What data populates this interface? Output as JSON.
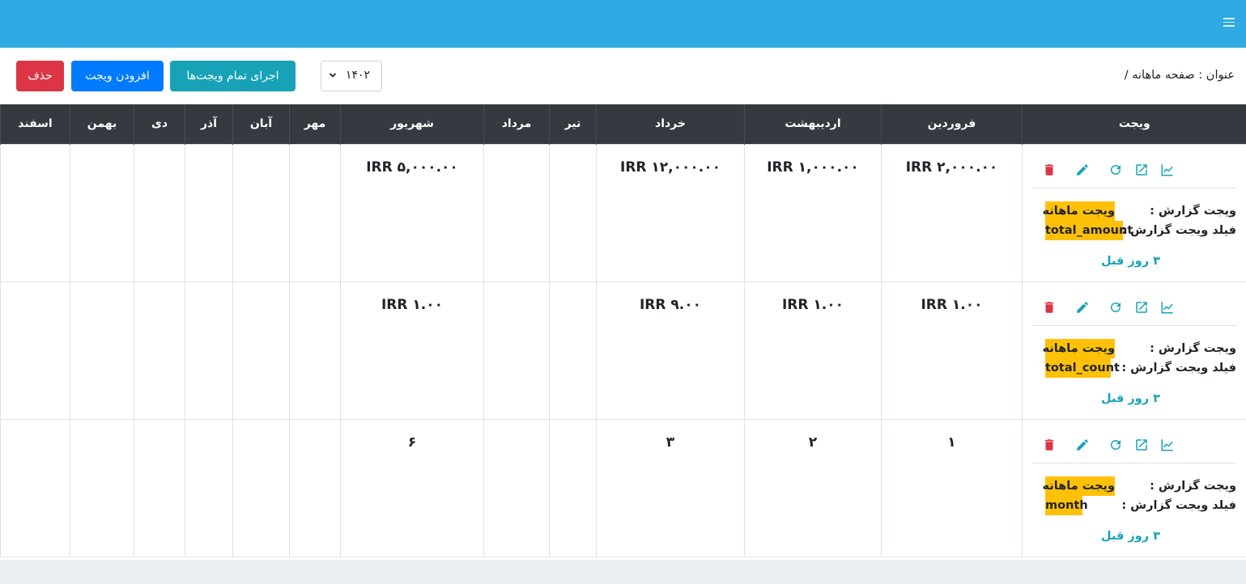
{
  "topbar": {
    "menu_icon": "hamburger-menu-icon",
    "color": "#2ea9e1"
  },
  "toolbar": {
    "title": "عنوان : صفحه ماهانه /",
    "year_value": "۱۴۰۲",
    "run_all_label": "اجرای تمام ویجت‌ها",
    "add_widget_label": "افزودن ویجت",
    "delete_label": "حذف"
  },
  "table": {
    "headers": [
      "ویجت",
      "فروردین",
      "اردیبهشت",
      "خرداد",
      "تیر",
      "مرداد",
      "شهریور",
      "مهر",
      "آبان",
      "آذر",
      "دی",
      "بهمن",
      "اسفند"
    ],
    "rows": [
      {
        "widget_label": "ویجت گزارش :",
        "widget_value": "ویجت ماهانه",
        "field_label": "فیلد ویجت گزارش :",
        "field_value": "total_amount",
        "ago": "۳ روز قبل",
        "cells": [
          "IRR ۲,۰۰۰.۰۰",
          "IRR ۱,۰۰۰.۰۰",
          "IRR ۱۲,۰۰۰.۰۰",
          "",
          "",
          "IRR ۵,۰۰۰.۰۰",
          "",
          "",
          "",
          "",
          "",
          ""
        ]
      },
      {
        "widget_label": "ویجت گزارش :",
        "widget_value": "ویجت ماهانه",
        "field_label": "فیلد ویجت گزارش :",
        "field_value": "total_count",
        "ago": "۳ روز قبل",
        "cells": [
          "IRR ۱.۰۰",
          "IRR ۱.۰۰",
          "IRR ۹.۰۰",
          "",
          "",
          "IRR ۱.۰۰",
          "",
          "",
          "",
          "",
          "",
          ""
        ]
      },
      {
        "widget_label": "ویجت گزارش :",
        "widget_value": "ویجت ماهانه",
        "field_label": "فیلد ویجت گزارش :",
        "field_value": "month",
        "ago": "۳ روز قبل",
        "cells": [
          "۱",
          "۲",
          "۳",
          "",
          "",
          "۶",
          "",
          "",
          "",
          "",
          "",
          ""
        ]
      }
    ],
    "row_action_icons": [
      "delete-icon",
      "edit-icon",
      "refresh-icon",
      "open-external-icon",
      "chart-icon"
    ]
  },
  "colors": {
    "header_bg": "#343a40",
    "run_button": "#17a2b8",
    "add_button": "#007bff",
    "delete_button": "#dc3545",
    "highlight": "#ffc107",
    "delete_icon": "#dc3545",
    "action_icon": "#17a2b8"
  }
}
